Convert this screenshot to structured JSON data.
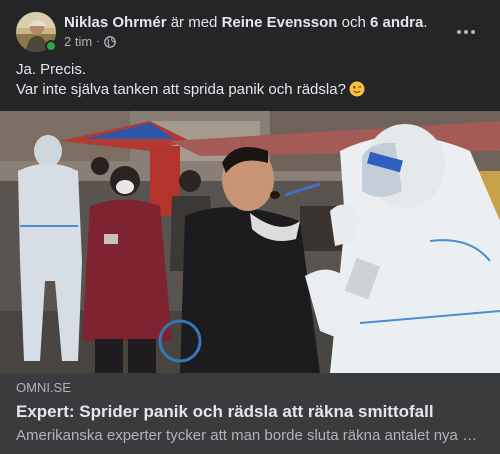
{
  "post": {
    "author": "Niklas Ohrmér",
    "with_text": "är med",
    "tagged_person": "Reine Evensson",
    "and_text": "och",
    "others": "6 andra",
    "period": ".",
    "time": "2 tim",
    "separator": "·",
    "privacy_icon": "globe-icon",
    "more_icon": "more-options-icon",
    "text_line1": "Ja. Precis.",
    "text_line2": "Var inte själva tanken att sprida panik och rädsla?",
    "emoji": "winking-face-emoji"
  },
  "link": {
    "domain": "OMNI.SE",
    "title": "Expert: Sprider panik och rädsla att räkna smittofall",
    "description": "Amerikanska experter tycker att man borde sluta räkna antalet nya smittofall"
  },
  "colors": {
    "background": "#242526",
    "link_box": "#3a3b3c",
    "primary_text": "#e4e6eb",
    "secondary_text": "#b0b3b8",
    "online": "#31a24c"
  }
}
